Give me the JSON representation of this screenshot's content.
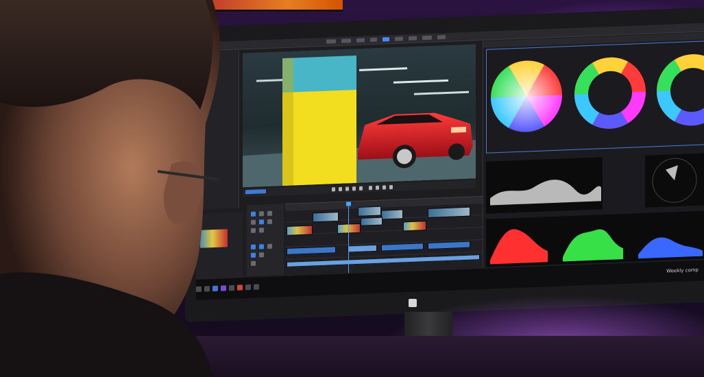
{
  "scene": {
    "description_items": [],
    "software": {
      "workspace_tabs": [
        "",
        "",
        "",
        "",
        "",
        "",
        "",
        "",
        "",
        ""
      ],
      "active_tab_index": 4
    },
    "taskbar": {
      "tray_text": "Weekly comp"
    },
    "scopes": {
      "wheel_colors": [
        "#ff3b3b",
        "#ffd23a",
        "#37e05a",
        "#3ac8ff",
        "#5a5aff",
        "#ff3aff"
      ],
      "parade_colors": [
        "#ff3030",
        "#38e048",
        "#3a68ff"
      ]
    },
    "colors": {
      "accent": "#4a8cff",
      "wall": "#2a1340",
      "car_red": "#d8202a",
      "pillar_yellow": "#f2dd1f",
      "pillar_cyan": "#49b6c7"
    }
  }
}
